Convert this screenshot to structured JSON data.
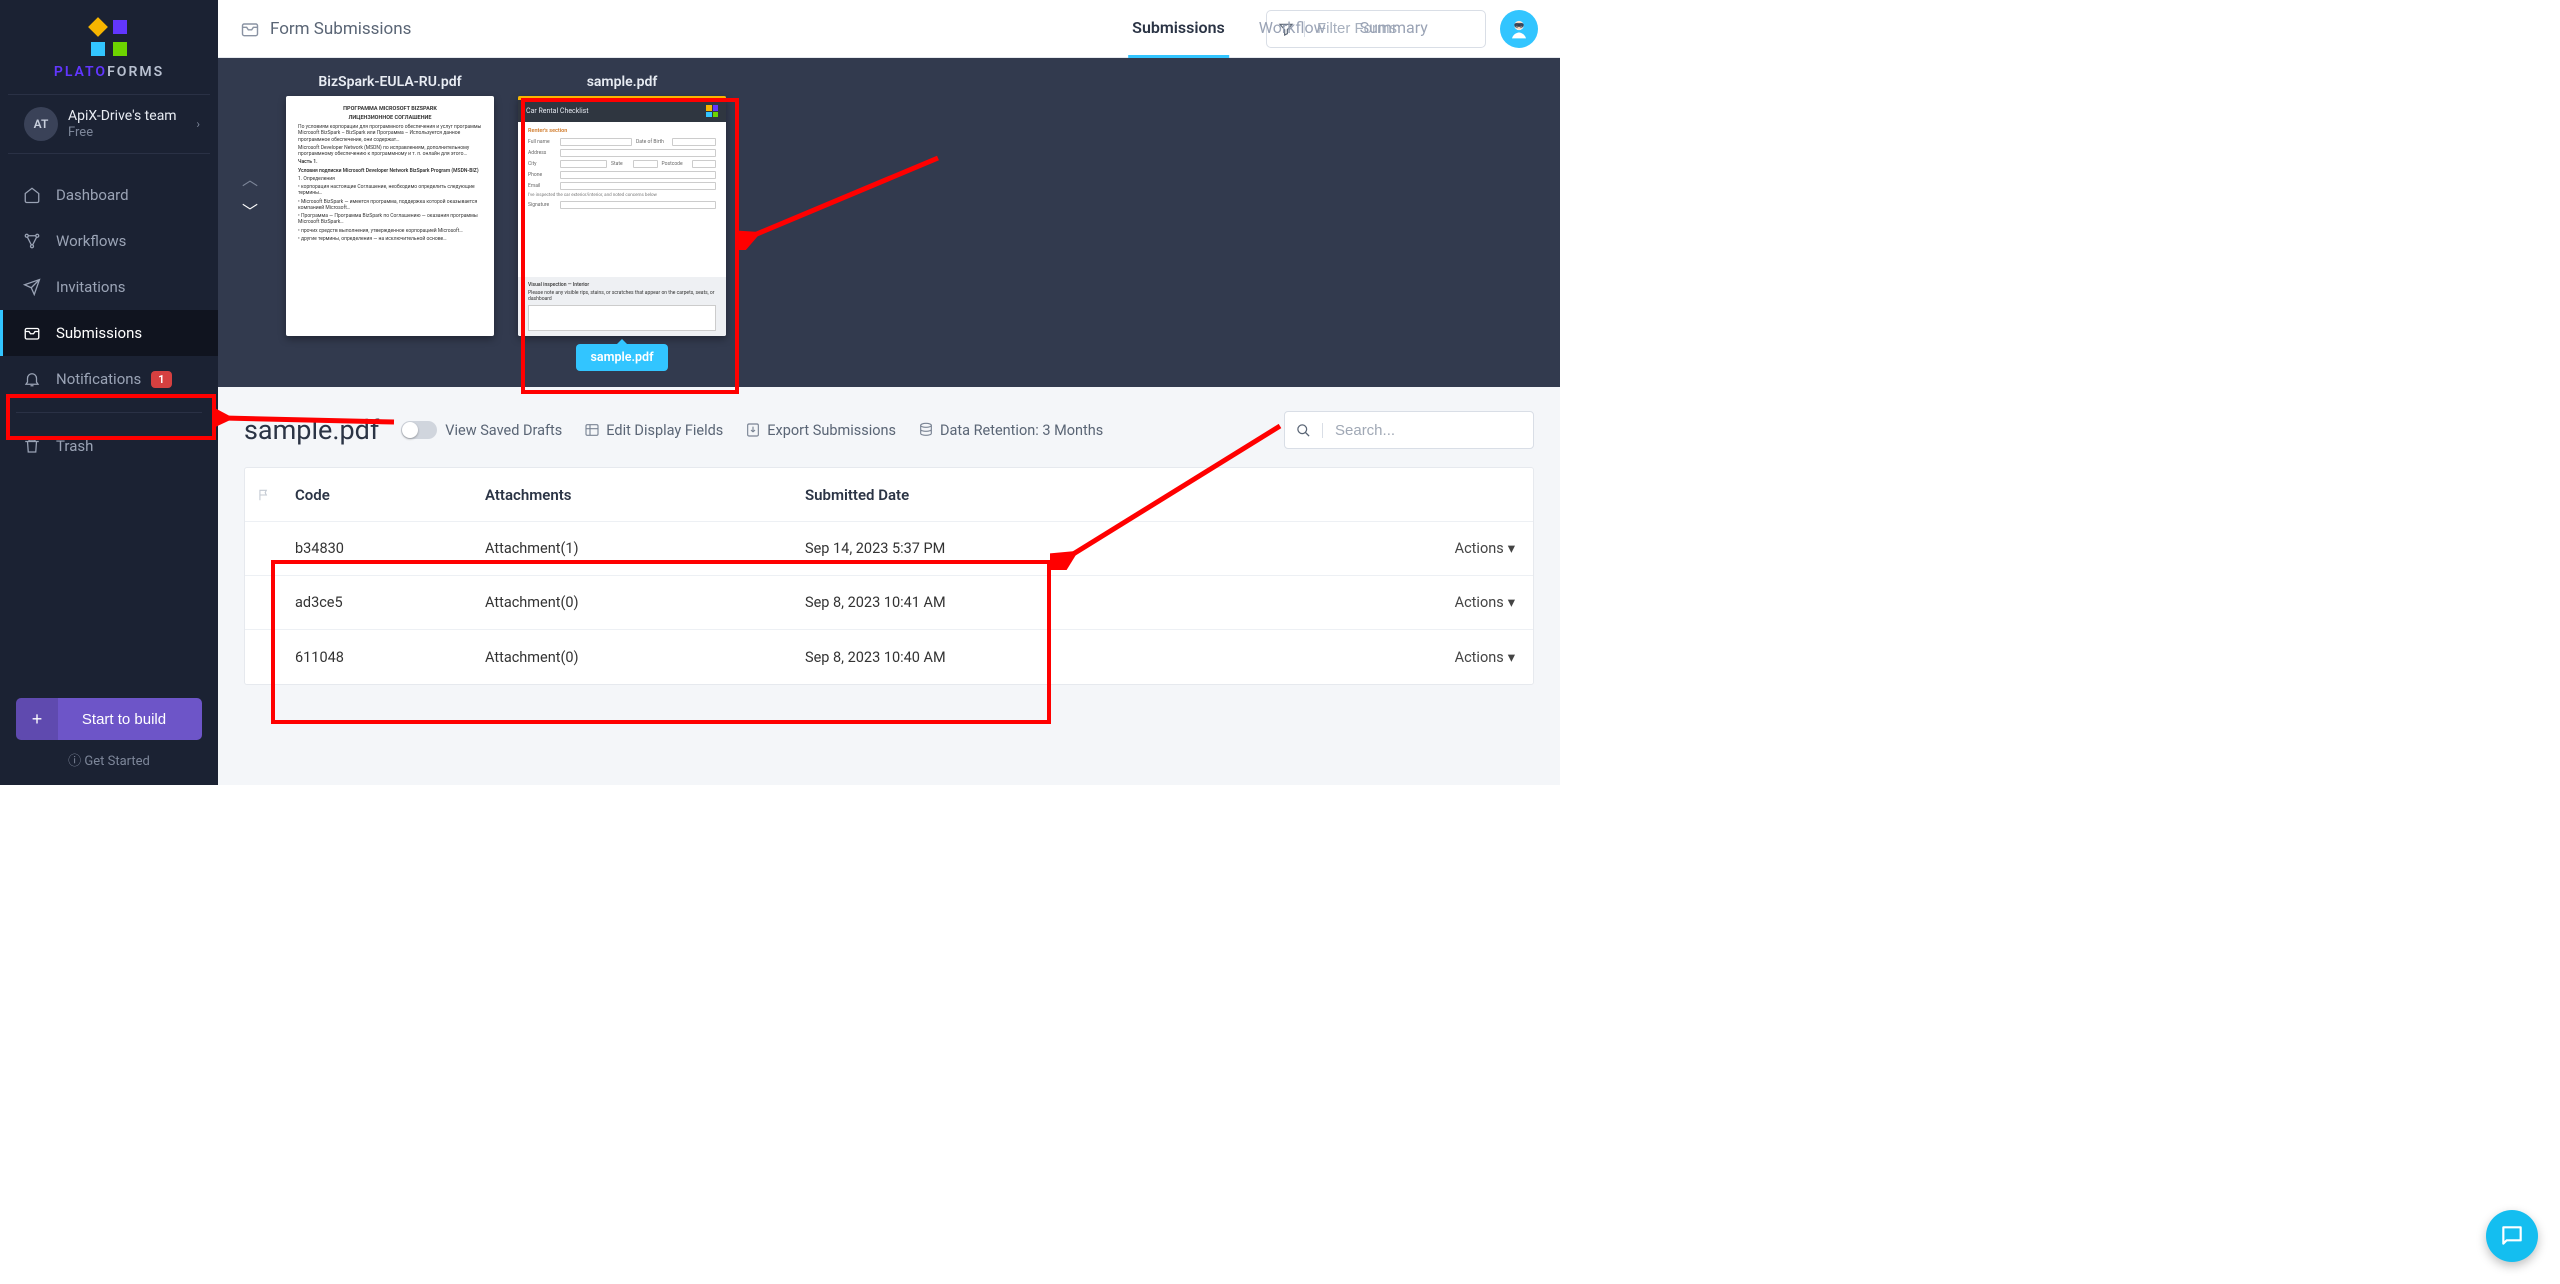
{
  "brand": {
    "name_left": "PLATO",
    "name_right": "FORMS"
  },
  "team": {
    "initials": "AT",
    "name": "ApiX-Drive's team",
    "plan": "Free"
  },
  "nav": {
    "dashboard": "Dashboard",
    "workflows": "Workflows",
    "invitations": "Invitations",
    "submissions": "Submissions",
    "notifications": "Notifications",
    "notifications_badge": "1",
    "trash": "Trash"
  },
  "sidebar_footer": {
    "start": "Start to build",
    "get_started": "Get Started"
  },
  "topbar": {
    "title": "Form Submissions",
    "tabs": {
      "submissions": "Submissions",
      "workflow": "Workflow",
      "summary": "Summary"
    },
    "filter_placeholder": "Filter Forms"
  },
  "forms": {
    "bizspark": {
      "title": "BizSpark-EULA-RU.pdf",
      "doc_heading1": "ПРОГРАММА MICROSOFT BIZSPARK",
      "doc_heading2": "ЛИЦЕНЗИОННОЕ СОГЛАШЕНИЕ"
    },
    "sample": {
      "title": "sample.pdf",
      "checklist_title": "Car Rental Checklist",
      "section": "Renter's section",
      "labels": {
        "full_name": "Full name",
        "dob": "Date of Birth",
        "address": "Address",
        "city": "City",
        "state": "State",
        "postcode": "Postcode",
        "phone": "Phone",
        "email": "Email",
        "signature": "Signature"
      },
      "note": "I've inspected the car exterior/interior, and noted concerns below",
      "grey_heading": "Visual inspection — Interior",
      "grey_sub": "Please note any visible rips, stains, or scratches that appear on the carpets, seats, or dashboard",
      "tooltip": "sample.pdf"
    }
  },
  "submissions": {
    "title": "sample.pdf",
    "view_saved_drafts": "View Saved Drafts",
    "edit_display_fields": "Edit Display Fields",
    "export": "Export Submissions",
    "data_retention": "Data Retention: 3 Months",
    "search_placeholder": "Search...",
    "columns": {
      "code": "Code",
      "attachments": "Attachments",
      "submitted": "Submitted Date"
    },
    "rows": [
      {
        "code": "b34830",
        "attachment": "Attachment(1)",
        "date": "Sep 14, 2023 5:37 PM",
        "actions": "Actions"
      },
      {
        "code": "ad3ce5",
        "attachment": "Attachment(0)",
        "date": "Sep 8, 2023 10:41 AM",
        "actions": "Actions"
      },
      {
        "code": "611048",
        "attachment": "Attachment(0)",
        "date": "Sep 8, 2023 10:40 AM",
        "actions": "Actions"
      }
    ]
  }
}
